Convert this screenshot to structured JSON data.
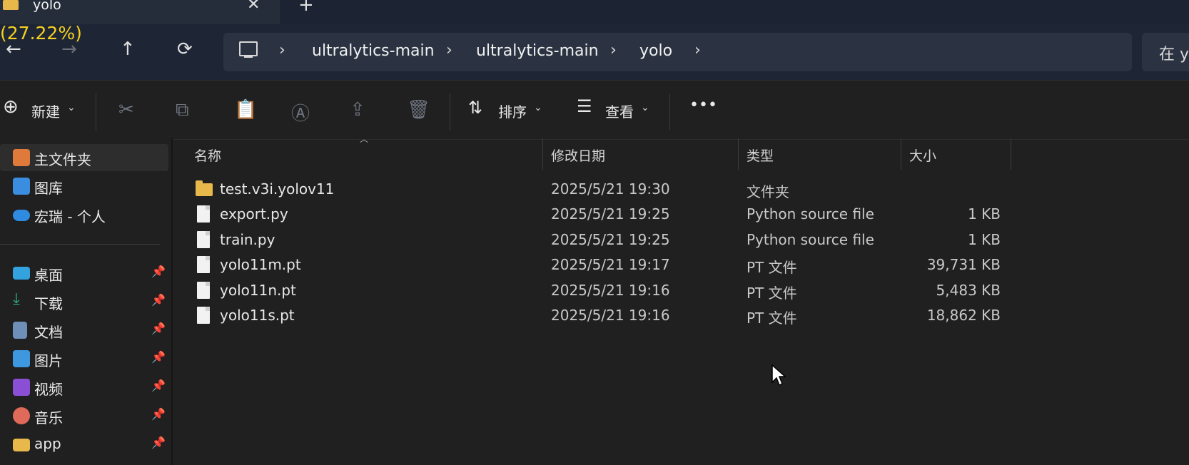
{
  "tab": {
    "title": "yolo",
    "close": "✕",
    "new_tab": "+"
  },
  "overlay_percentage": "(27.22%)",
  "nav": {
    "back": "←",
    "forward": "→",
    "up": "↑",
    "refresh": "⟳"
  },
  "breadcrumb": {
    "separator": "›",
    "items": [
      "ultralytics-main",
      "ultralytics-main",
      "yolo"
    ]
  },
  "search": {
    "text": "在 y"
  },
  "toolbar": {
    "new_label": "新建",
    "sort_label": "排序",
    "view_label": "查看",
    "more": "•••",
    "caret": "⌄"
  },
  "sidebar": {
    "top": [
      {
        "label": "主文件夹",
        "icon": "home-icon",
        "color": "#e07a3a"
      },
      {
        "label": "图库",
        "icon": "gallery-icon",
        "color": "#3b8de0"
      },
      {
        "label": "宏瑞 - 个人",
        "icon": "cloud-icon",
        "color": "#2f8be0"
      }
    ],
    "pinned": [
      {
        "label": "桌面",
        "icon": "desktop-icon",
        "color": "#33a3e0"
      },
      {
        "label": "下载",
        "icon": "download-icon",
        "color": "#2fb48a"
      },
      {
        "label": "文档",
        "icon": "documents-icon",
        "color": "#6d8fb8"
      },
      {
        "label": "图片",
        "icon": "pictures-icon",
        "color": "#3e98e0"
      },
      {
        "label": "视频",
        "icon": "videos-icon",
        "color": "#8b4fd6"
      },
      {
        "label": "音乐",
        "icon": "music-icon",
        "color": "#e06a5a"
      },
      {
        "label": "app",
        "icon": "folder-icon",
        "color": "#e9b84a"
      }
    ],
    "pin_glyph": "📌"
  },
  "columns": {
    "name": "名称",
    "modified": "修改日期",
    "type": "类型",
    "size": "大小"
  },
  "files": [
    {
      "name": "test.v3i.yolov11",
      "modified": "2025/5/21 19:30",
      "type": "文件夹",
      "size": "",
      "kind": "folder"
    },
    {
      "name": "export.py",
      "modified": "2025/5/21 19:25",
      "type": "Python source file",
      "size": "1 KB",
      "kind": "file"
    },
    {
      "name": "train.py",
      "modified": "2025/5/21 19:25",
      "type": "Python source file",
      "size": "1 KB",
      "kind": "file"
    },
    {
      "name": "yolo11m.pt",
      "modified": "2025/5/21 19:17",
      "type": "PT 文件",
      "size": "39,731 KB",
      "kind": "file"
    },
    {
      "name": "yolo11n.pt",
      "modified": "2025/5/21 19:16",
      "type": "PT 文件",
      "size": "5,483 KB",
      "kind": "file"
    },
    {
      "name": "yolo11s.pt",
      "modified": "2025/5/21 19:16",
      "type": "PT 文件",
      "size": "18,862 KB",
      "kind": "file"
    }
  ]
}
